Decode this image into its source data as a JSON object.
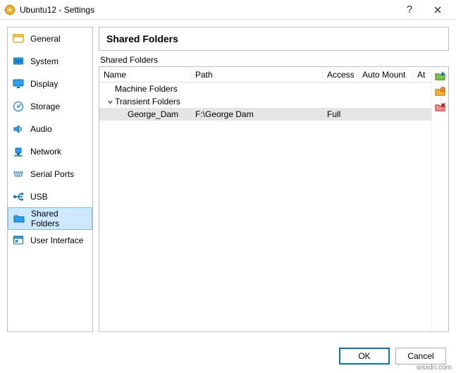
{
  "window": {
    "title": "Ubuntu12 - Settings"
  },
  "sidebar": {
    "items": [
      {
        "label": "General"
      },
      {
        "label": "System"
      },
      {
        "label": "Display"
      },
      {
        "label": "Storage"
      },
      {
        "label": "Audio"
      },
      {
        "label": "Network"
      },
      {
        "label": "Serial Ports"
      },
      {
        "label": "USB"
      },
      {
        "label": "Shared Folders"
      },
      {
        "label": "User Interface"
      }
    ]
  },
  "main": {
    "header": "Shared Folders",
    "section_label": "Shared Folders",
    "columns": {
      "name": "Name",
      "path": "Path",
      "access": "Access",
      "automount": "Auto Mount",
      "at": "At"
    },
    "groups": {
      "machine": "Machine Folders",
      "transient": "Transient Folders"
    },
    "entry": {
      "name": "George_Dam",
      "path": "F:\\George Dam",
      "access": "Full",
      "automount": "",
      "at": ""
    }
  },
  "buttons": {
    "ok": "OK",
    "cancel": "Cancel"
  },
  "watermark": "wsxdn.com"
}
